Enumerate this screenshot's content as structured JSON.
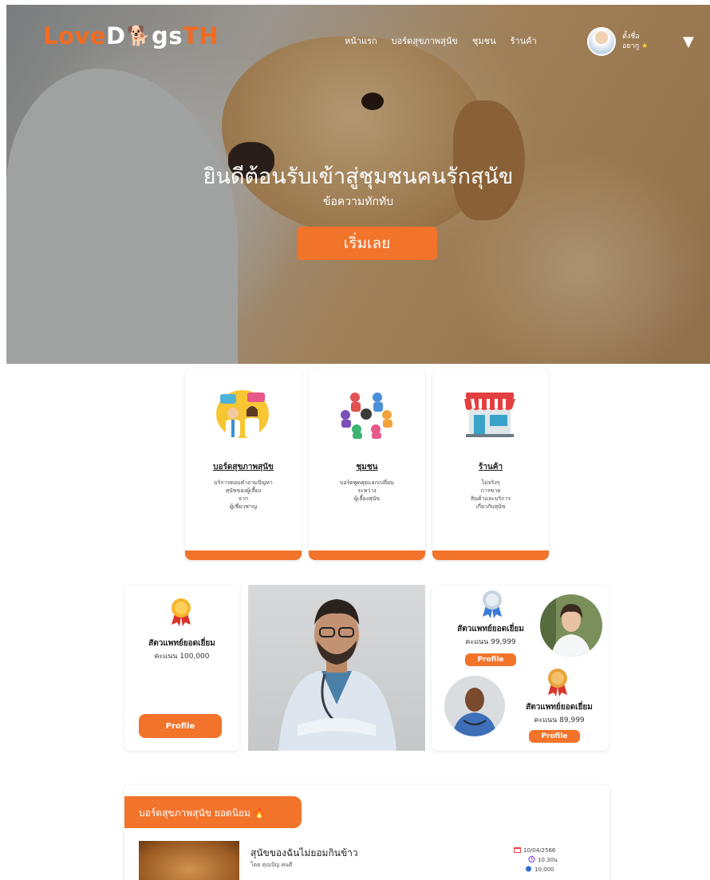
{
  "brand": {
    "love": "Love",
    "d": "D",
    "paw": "🐕",
    "gs": "gs",
    "th": "TH"
  },
  "nav": {
    "items": [
      "หน้าแรก",
      "บอร์ดสุขภาพสุนัข",
      "ชุมชน",
      "ร้านค้า"
    ]
  },
  "user": {
    "name_line1": "ตั้งชื่อ",
    "name_line2": "อยากู",
    "star": "★"
  },
  "hero": {
    "title": "ยินดีต้อนรับเข้าสู่ชุมชนคนรักสุนัข",
    "subtitle": "ข้อความทักทับ",
    "cta": "เริ่มเลย"
  },
  "services": [
    {
      "title": "บอร์ดสุขภาพสุนัข",
      "desc": [
        "บริการตอบคำถามปัญหา",
        "สุนัขของผู้เลี้ยง",
        "จาก",
        "ผู้เชี่ยวชาญ"
      ]
    },
    {
      "title": "ชุมชน",
      "desc": [
        "บอร์ดพูดคุยแลกเปลี่ยน",
        "ระหว่าง",
        "ผู้เลี้ยงสุนัข"
      ]
    },
    {
      "title": "ร้านค้า",
      "desc": [
        "ไม่จริงๆ",
        "การขาย",
        "สินค้าและบริการ",
        "เกี่ยวกับสุนัข"
      ]
    }
  ],
  "vets": {
    "first": {
      "title": "สัตวแพทย์ยอดเยี่ยม",
      "score": "คะแนน 100,000",
      "button": "Profile"
    },
    "second": {
      "title": "สัตวแพทย์ยอดเยี่ยม",
      "score": "คะแนน 99,999",
      "button": "Profile"
    },
    "third": {
      "title": "สัตวแพทย์ยอดเยี่ยม",
      "score": "คะแนน 89,999",
      "button": "Profile"
    }
  },
  "board": {
    "tab": "บอร์ดสุขภาพสุนัข ยอดนิยม",
    "tab_icon": "🔥",
    "post": {
      "title": "สุนัขของฉันไม่ยอมกินข้าว",
      "by": "โดย คุณปัญ คนดี",
      "date": "10/04/2566",
      "time": "10.30น",
      "views": "10,000"
    }
  },
  "colors": {
    "accent": "#f2732a",
    "text": "#222222"
  }
}
